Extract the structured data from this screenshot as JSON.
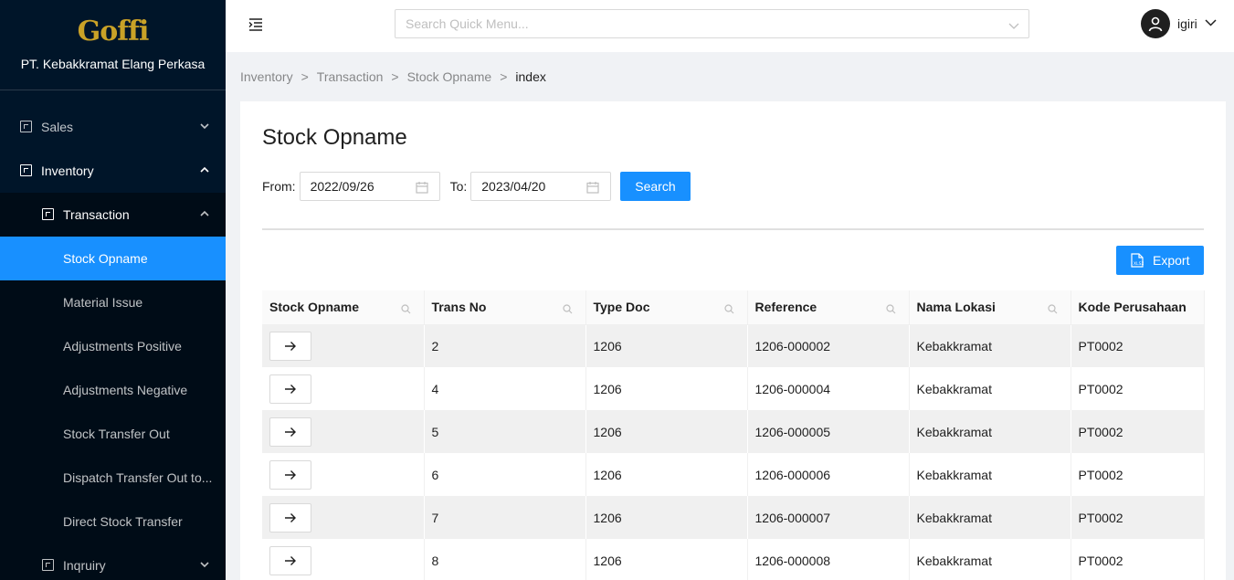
{
  "brand": {
    "logo_text": "Goffi",
    "company": "PT. Kebakkramat Elang Perkasa"
  },
  "sidebar": {
    "sales": "Sales",
    "inventory": "Inventory",
    "transaction": "Transaction",
    "items": [
      "Stock Opname",
      "Material Issue",
      "Adjustments Positive",
      "Adjustments Negative",
      "Stock Transfer Out",
      "Dispatch Transfer Out to...",
      "Direct Stock Transfer"
    ],
    "inquiry": "Inqruiry",
    "active_item": "Stock Opname"
  },
  "header": {
    "search_placeholder": "Search Quick Menu...",
    "username": "igiri"
  },
  "breadcrumb": [
    "Inventory",
    "Transaction",
    "Stock Opname",
    "index"
  ],
  "page": {
    "title": "Stock Opname",
    "from_label": "From",
    "from_value": "2022/09/26",
    "to_label": "To",
    "to_value": "2023/04/20",
    "search_label": "Search",
    "export_label": "Export"
  },
  "table": {
    "columns": [
      "Stock Opname",
      "Trans No",
      "Type Doc",
      "Reference",
      "Nama Lokasi",
      "Kode Perusahaan"
    ],
    "rows": [
      {
        "trans_no": "2",
        "type_doc": "1206",
        "reference": "1206-000002",
        "lokasi": "Kebakkramat",
        "kode": "PT0002"
      },
      {
        "trans_no": "4",
        "type_doc": "1206",
        "reference": "1206-000004",
        "lokasi": "Kebakkramat",
        "kode": "PT0002"
      },
      {
        "trans_no": "5",
        "type_doc": "1206",
        "reference": "1206-000005",
        "lokasi": "Kebakkramat",
        "kode": "PT0002"
      },
      {
        "trans_no": "6",
        "type_doc": "1206",
        "reference": "1206-000006",
        "lokasi": "Kebakkramat",
        "kode": "PT0002"
      },
      {
        "trans_no": "7",
        "type_doc": "1206",
        "reference": "1206-000007",
        "lokasi": "Kebakkramat",
        "kode": "PT0002"
      },
      {
        "trans_no": "8",
        "type_doc": "1206",
        "reference": "1206-000008",
        "lokasi": "Kebakkramat",
        "kode": "PT0002"
      }
    ]
  },
  "colors": {
    "sidebar_bg": "#001529",
    "submenu_bg": "#000c17",
    "primary": "#1890ff",
    "logo": "#c9a227"
  },
  "icons": {
    "menu": "menu-fold-icon",
    "avatar": "user-icon",
    "calendar": "calendar-icon",
    "export": "file-excel-icon",
    "row_action": "arrow-right-icon",
    "column_search": "search-icon"
  }
}
